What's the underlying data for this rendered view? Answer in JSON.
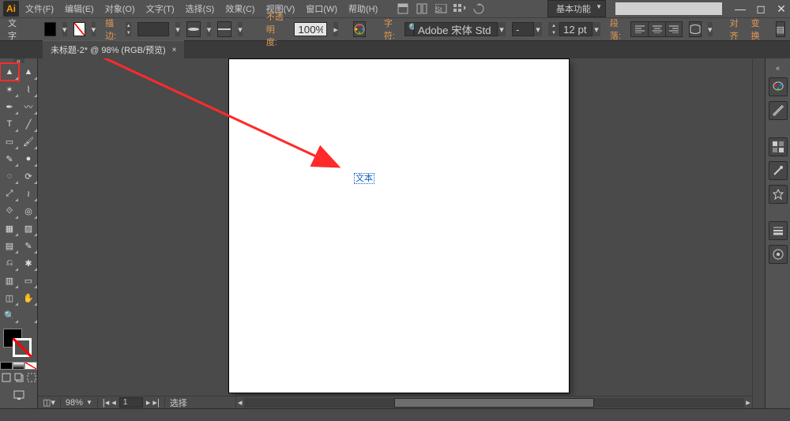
{
  "menubar": {
    "items": [
      "文件(F)",
      "编辑(E)",
      "对象(O)",
      "文字(T)",
      "选择(S)",
      "效果(C)",
      "视图(V)",
      "窗口(W)",
      "帮助(H)"
    ],
    "workspace": "基本功能",
    "search_placeholder": ""
  },
  "options": {
    "tool_label": "文字",
    "transform_label": "描边:",
    "stroke_pt": "",
    "opacity_label": "不透明度:",
    "opacity_value": "100%",
    "char_label": "字符:",
    "font_value": "Adobe 宋体 Std L",
    "font_style": "-",
    "font_size": "12 pt",
    "para_label": "段落:",
    "align_label": "对齐",
    "transform2_label": "变换"
  },
  "tab": {
    "title": "未标题-2* @ 98% (RGB/预览)",
    "close": "×"
  },
  "canvas": {
    "text_object": "文本"
  },
  "status": {
    "zoom": "98%",
    "page": "1",
    "mode": "选择"
  },
  "tool_names": [
    "selection-tool",
    "direct-selection-tool",
    "magic-wand-tool",
    "lasso-tool",
    "pen-tool",
    "curvature-tool",
    "type-tool",
    "line-segment-tool",
    "rectangle-tool",
    "paintbrush-tool",
    "pencil-tool",
    "blob-brush-tool",
    "eraser-tool",
    "rotate-tool",
    "scale-tool",
    "width-tool",
    "free-transform-tool",
    "shape-builder-tool",
    "perspective-grid-tool",
    "mesh-tool",
    "gradient-tool",
    "eyedropper-tool",
    "blend-tool",
    "symbol-sprayer-tool",
    "column-graph-tool",
    "artboard-tool",
    "slice-tool",
    "hand-tool",
    "zoom-tool",
    ""
  ],
  "tool_glyphs": [
    "▲",
    "▲",
    "✶",
    "⌇",
    "✒",
    "〰",
    "T",
    "╱",
    "▭",
    "🖌",
    "✎",
    "●",
    "◌",
    "⟳",
    "⤢",
    "≀",
    "⟐",
    "◎",
    "▦",
    "▨",
    "▤",
    "✎",
    "⎌",
    "✱",
    "▥",
    "▭",
    "◫",
    "✋",
    "🔍",
    ""
  ]
}
